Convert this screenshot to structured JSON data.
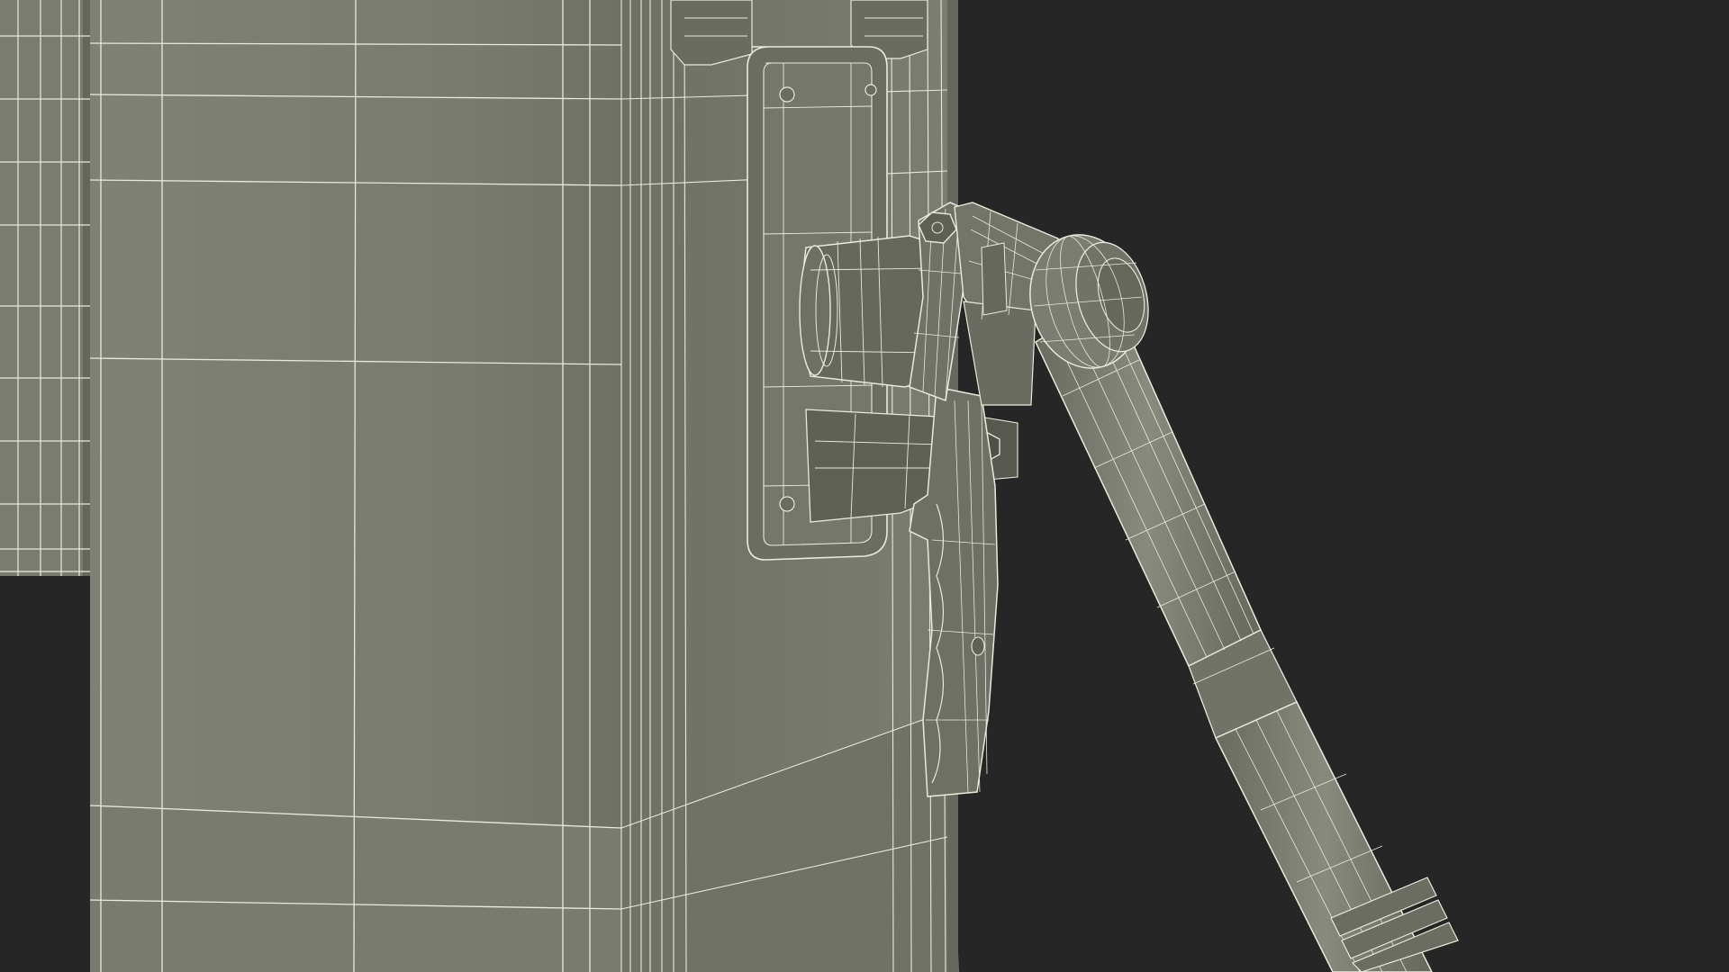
{
  "scene": {
    "background": "#262626",
    "surface_color": "#7a7b6f",
    "surface_dark": "#6c6d62",
    "surface_shadow": "#5f6056",
    "wire_color": "#e9eadc",
    "hose_dark": "#585950"
  }
}
